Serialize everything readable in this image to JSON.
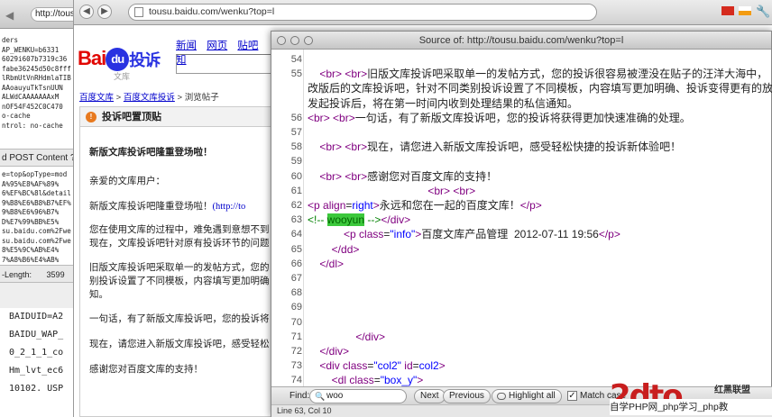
{
  "left_window": {
    "url": "http://tousu",
    "lines": [
      "ders",
      "AP_WENKU=b6331",
      "6029i607b7319c36",
      "fabe36245d50c8fff",
      "lRbmUtVnRHdmlaTIB",
      "AAoauyuTkTsnUUN",
      "ALWdCAAAAAAAxM",
      "nOF54F452C0C470",
      "o-cache",
      "ntrol: no-cache"
    ],
    "post_label": "d POST Content ?",
    "post_lines": [
      "e=top&opType=mod",
      "A%95%E8%AF%89%",
      "6%EF%BC%8l&detail",
      "9%B8%E6%B8%B7%EF%",
      "9%B8%E6%96%B7%",
      "D%E7%99%BB%E5%",
      "su.baidu.com%2Fwe",
      "su.baidu.com%2Fwe",
      "8%E5%9C%AB%E4%",
      "7%A8%B6%E4%AB%"
    ],
    "length_label": "-Length:",
    "length_value": "3599",
    "cookie_lines": [
      "BAIDUID=A2",
      "BAIDU_WAP_",
      "0_2_1_1_co",
      "Hm_lvt_ec6",
      "10102. USP"
    ]
  },
  "browser": {
    "address": "tousu.baidu.com/wenku?top=l"
  },
  "page": {
    "logo_text": "Bai",
    "logo_du": "du",
    "logo_tousu": "投诉",
    "logo_sub": "文库",
    "nav": [
      "新闻",
      "网页",
      "贴吧",
      "知"
    ],
    "breadcrumb": {
      "a": "百度文库",
      "sep": " > ",
      "b": "百度文库投诉",
      "c": "浏览帖子"
    },
    "panel_title": "投诉吧置顶贴",
    "post_title": "新版文库投诉吧隆重登场啦！",
    "greeting": "亲爱的文库用户：",
    "p1": "新版文库投诉吧隆重登场啦！",
    "p1_link": "(http://to",
    "p2a": "您在使用文库的过程中，难免遇到意想不到",
    "p2b": "现在，文库投诉吧针对原有投诉环节的问题",
    "p3a": "旧版文库投诉吧采取单一的发帖方式，您的",
    "p3b": "别投诉设置了不同模板，内容填写更加明确",
    "p3c": "知。",
    "p4": "一句话，有了新版文库投诉吧，您的投诉将",
    "p5": "现在，请您进入新版文库投诉吧，感受轻松",
    "p6": "感谢您对百度文库的支持！"
  },
  "source": {
    "title": "Source of: http://tousu.baidu.com/wenku?top=l",
    "lines": [
      {
        "n": "54",
        "t": ""
      },
      {
        "n": "55",
        "t": "    <br> <br>旧版文库投诉吧采取单一的发帖方式，您的投诉很容易被湮没在贴子的汪洋大海中，"
      },
      {
        "n": "",
        "t": "改版后的文库投诉吧，针对不同类别投诉设置了不同模板，内容填写更加明确、投诉变得更有的放"
      },
      {
        "n": "",
        "t": "发起投诉后，将在第一时间内收到处理结果的私信通知。"
      },
      {
        "n": "56",
        "t": "<br> <br>一句话，有了新版文库投诉吧，您的投诉将获得更加快速准确的处理。"
      },
      {
        "n": "57",
        "t": ""
      },
      {
        "n": "58",
        "t": "    <br> <br>现在，请您进入新版文库投诉吧，感受轻松快捷的投诉新体验吧！"
      },
      {
        "n": "59",
        "t": ""
      },
      {
        "n": "60",
        "t": "    <br> <br>感谢您对百度文库的支持！"
      },
      {
        "n": "61",
        "t": "                                        <br> <br>"
      },
      {
        "n": "62",
        "t": "<p align=right>永远和您在一起的百度文库！</p>"
      },
      {
        "n": "63",
        "t": "<!-- wooyun --></div>"
      },
      {
        "n": "64",
        "t": "            <p class=\"info\">百度文库产品管理  2012-07-11 19:56</p>"
      },
      {
        "n": "65",
        "t": "        </dd>"
      },
      {
        "n": "66",
        "t": "    </dl>"
      },
      {
        "n": "67",
        "t": ""
      },
      {
        "n": "68",
        "t": ""
      },
      {
        "n": "69",
        "t": ""
      },
      {
        "n": "70",
        "t": ""
      },
      {
        "n": "71",
        "t": "                </div>"
      },
      {
        "n": "72",
        "t": "    </div>"
      },
      {
        "n": "73",
        "t": "    <div class=\"col2\" id=col2>"
      },
      {
        "n": "74",
        "t": "        <dl class=\"box_y\">"
      }
    ],
    "find_label": "Find:",
    "find_value": "woo",
    "next_label": "Next",
    "previous_label": "Previous",
    "highlight_label": "Highlight all",
    "matchcase_label": "Match case",
    "status": "Line 63, Col 10"
  },
  "watermark": {
    "big": "2dto",
    "side": "红黑联盟",
    "text": "自学PHP网_php学习_php教"
  }
}
